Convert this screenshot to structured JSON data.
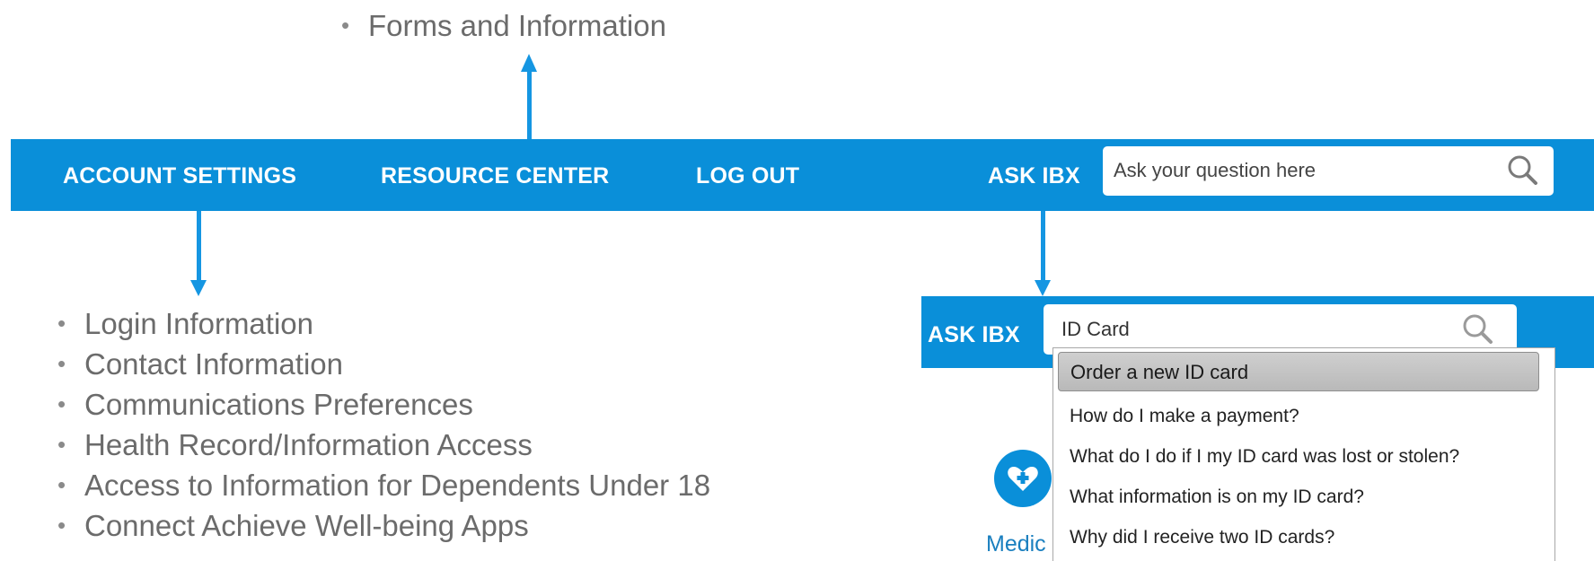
{
  "resource_center_items": [
    "Forms and Information"
  ],
  "nav": {
    "account_settings": "ACCOUNT SETTINGS",
    "resource_center": "RESOURCE CENTER",
    "log_out": "LOG OUT",
    "ask_label": "ASK IBX",
    "search_placeholder": "Ask your question here"
  },
  "account_settings_items": [
    "Login Information",
    "Contact Information",
    "Communications Preferences",
    "Health Record/Information Access",
    "Access to Information for Dependents Under 18",
    "Connect Achieve Well-being Apps"
  ],
  "ask_panel": {
    "label": "ASK IBX",
    "query": "ID Card",
    "suggestions": [
      "Order a new ID card",
      "How do I make a payment?",
      "What do I do if I my ID card was lost or stolen?",
      "What information is on my ID card?",
      "Why did I receive two ID cards?"
    ],
    "behind_label": "Medic"
  },
  "colors": {
    "bar_blue": "#0a8fd9",
    "arrow_blue": "#1596e2",
    "bullet_text": "#6b6b6b"
  },
  "icons": [
    "magnifier-icon",
    "heart-plus-icon"
  ]
}
